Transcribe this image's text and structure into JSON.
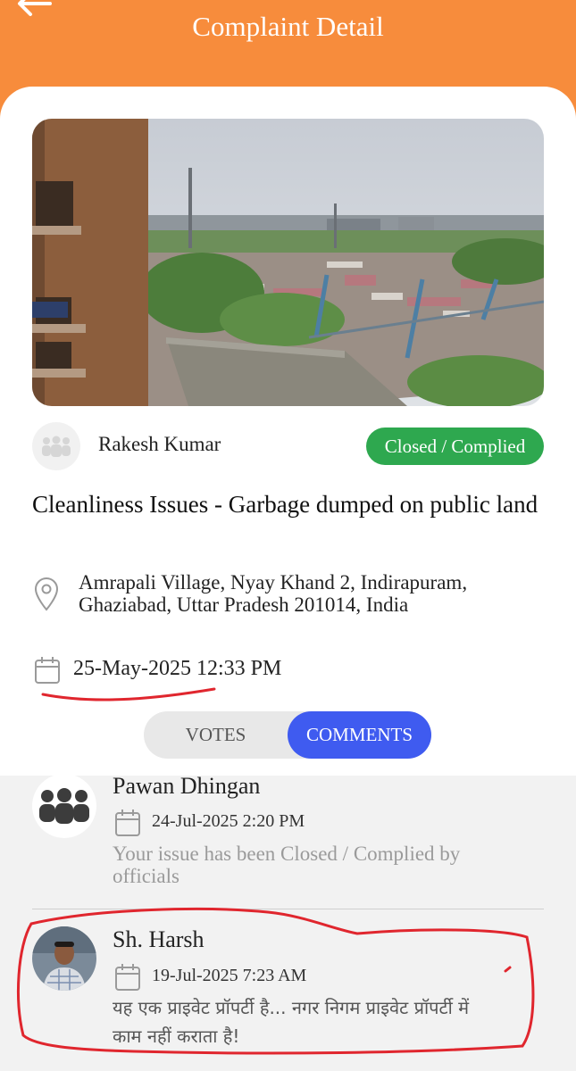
{
  "header": {
    "title": "Complaint Detail",
    "back_icon": "back-arrow-icon",
    "color": "#f78c3c"
  },
  "complaint": {
    "author": "Rakesh Kumar",
    "status": "Closed / Complied",
    "status_color": "#2ea84f",
    "title": "Cleanliness Issues - Garbage dumped on public land",
    "address": "Amrapali Village, Nyay Khand 2, Indirapuram, Ghaziabad, Uttar Pradesh 201014, India",
    "date": "25-May-2025 12:33 PM"
  },
  "tabs": {
    "votes": "VOTES",
    "comments": "COMMENTS",
    "active": "comments",
    "active_color": "#3f5bf0"
  },
  "comments": [
    {
      "name": "Pawan Dhingan",
      "date": "24-Jul-2025 2:20 PM",
      "text": "Your issue has been Closed / Complied by officials"
    },
    {
      "name": "Sh. Harsh",
      "date": "19-Jul-2025 7:23 AM",
      "text": "यह एक प्राइवेट प्रॉपर्टी है... नगर निगम प्राइवेट प्रॉपर्टी में काम नहीं कराता है!"
    }
  ]
}
